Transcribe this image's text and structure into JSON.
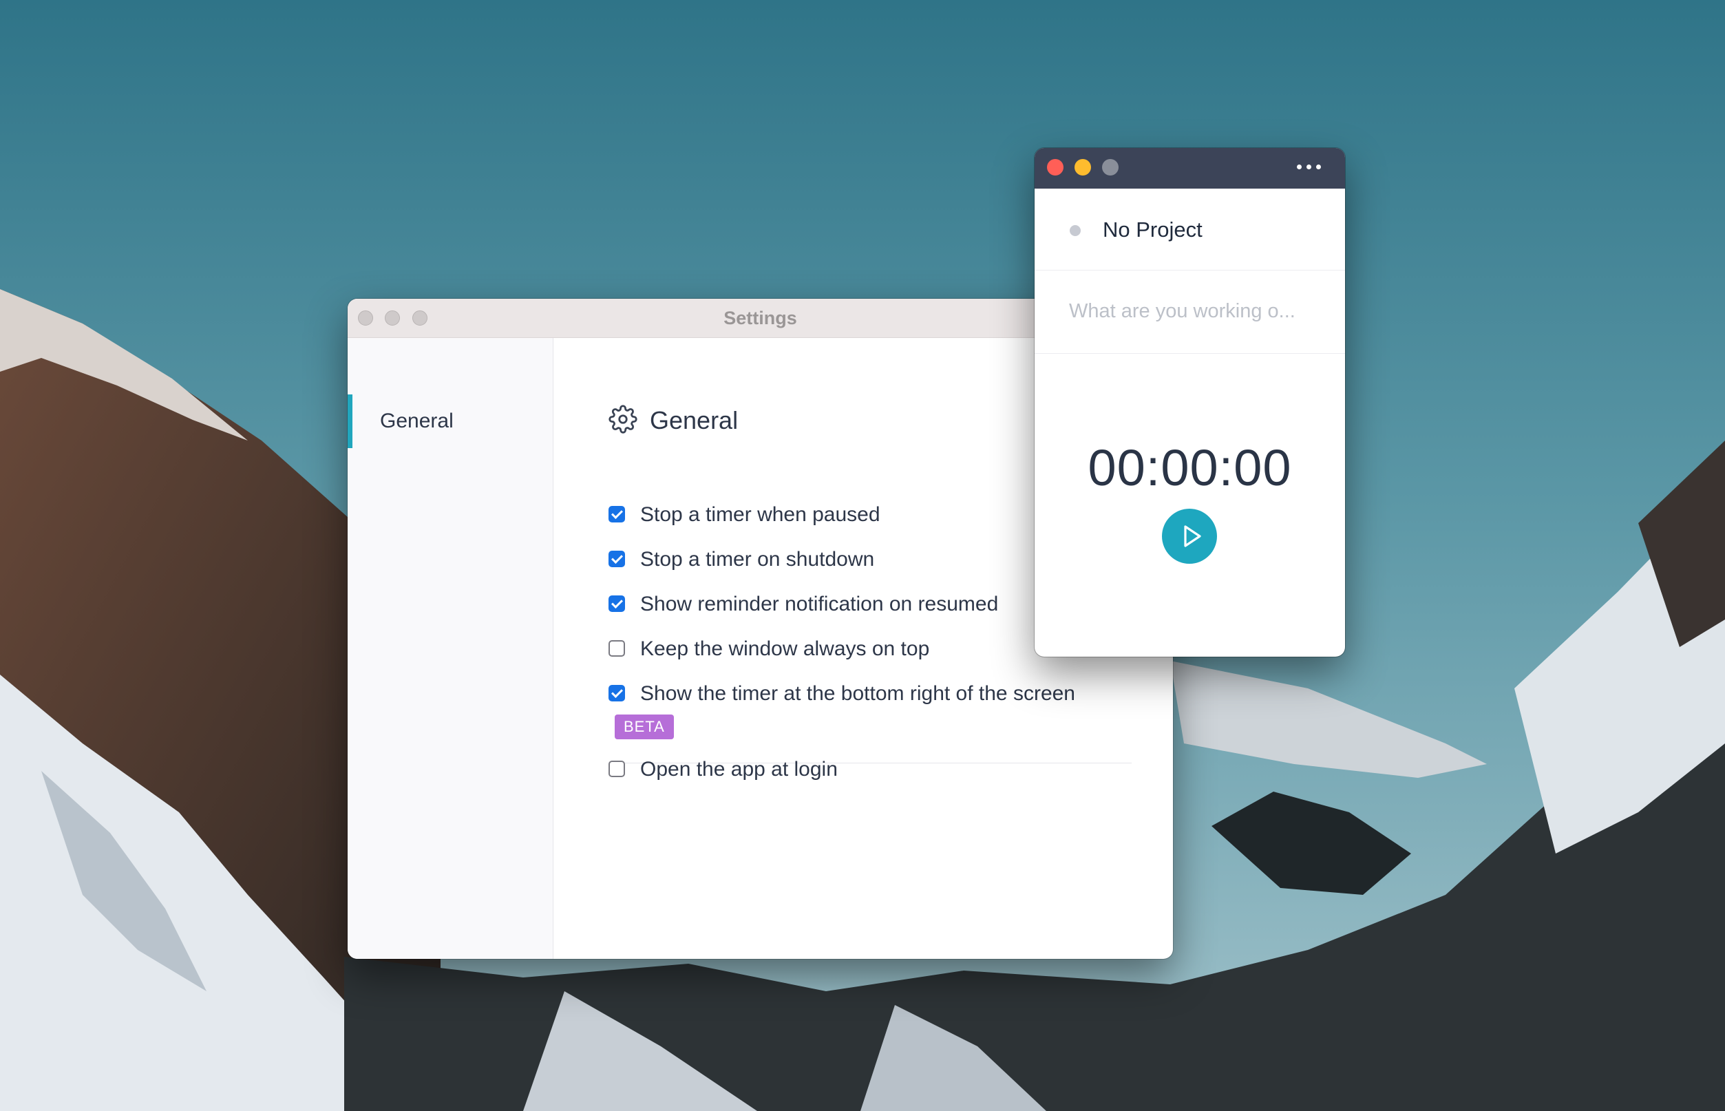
{
  "settings": {
    "title": "Settings",
    "sidebar": {
      "items": [
        {
          "label": "General",
          "active": true
        }
      ]
    },
    "section": {
      "title": "General",
      "icon": "gear-icon"
    },
    "options": [
      {
        "label": "Stop a timer when paused",
        "checked": true
      },
      {
        "label": "Stop a timer on shutdown",
        "checked": true
      },
      {
        "label": "Show reminder notification on resumed",
        "checked": true
      },
      {
        "label": "Keep the window always on top",
        "checked": false
      },
      {
        "label": "Show the timer at the bottom right of the screen",
        "checked": true,
        "badge": "BETA"
      },
      {
        "label": "Open the app at login",
        "checked": false
      }
    ]
  },
  "timer": {
    "project": "No Project",
    "task_placeholder": "What are you working o...",
    "time": "00:00:00",
    "icons": {
      "menu": "more-dots-icon",
      "play": "play-icon"
    }
  },
  "colors": {
    "accent": "#1ea7bf",
    "checkbox": "#1772e6",
    "beta_badge": "#b66ed8",
    "timer_titlebar": "#3c4458"
  }
}
